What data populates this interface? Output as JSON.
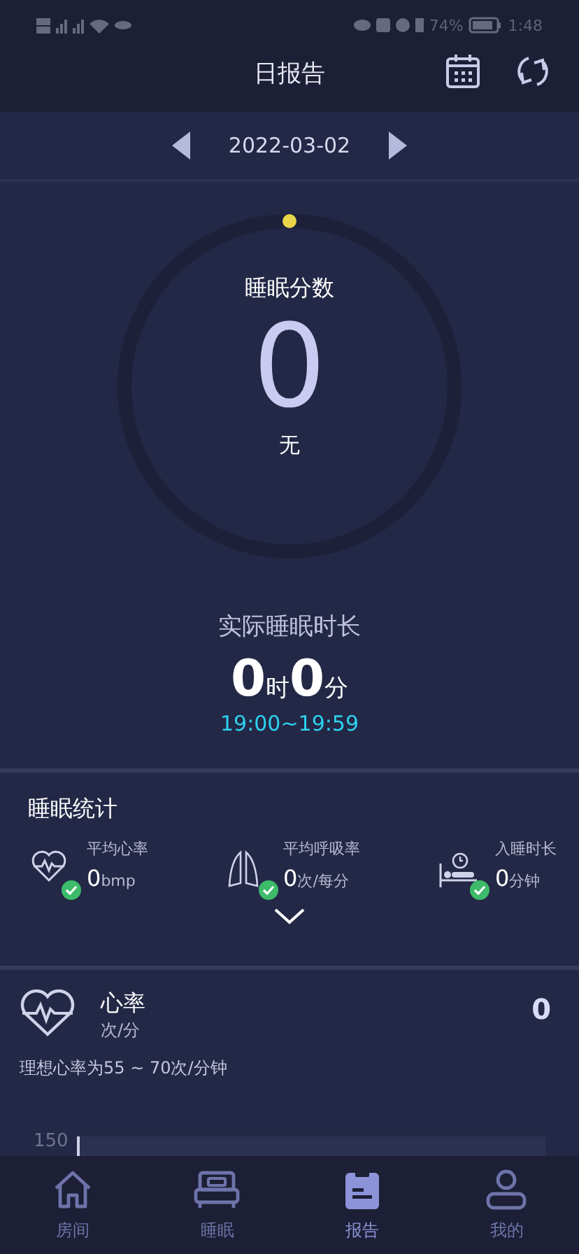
{
  "status_bar": {
    "battery": "74%",
    "time": "1:48"
  },
  "header": {
    "title": "日报告"
  },
  "date_bar": {
    "date": "2022-03-02"
  },
  "score": {
    "label": "睡眠分数",
    "value": "0",
    "grade": "无"
  },
  "duration": {
    "label": "实际睡眠时长",
    "hours": "0",
    "hours_unit": "时",
    "minutes": "0",
    "minutes_unit": "分",
    "range": "19:00~19:59"
  },
  "stats": {
    "title": "睡眠统计",
    "items": [
      {
        "kind": "heart",
        "label": "平均心率",
        "value": "0",
        "unit": "bmp",
        "ok": true
      },
      {
        "kind": "lungs",
        "label": "平均呼吸率",
        "value": "0",
        "unit": "次/每分",
        "ok": true
      },
      {
        "kind": "bed",
        "label": "入睡时长",
        "value": "0",
        "unit": "分钟",
        "ok": true
      }
    ]
  },
  "heart_rate": {
    "title": "心率",
    "unit": "次/分",
    "value": "0",
    "note": "理想心率为55 ~ 70次/分钟",
    "axis_label": "150"
  },
  "nav": [
    {
      "kind": "home",
      "label": "房间",
      "selected": false
    },
    {
      "kind": "bed",
      "label": "睡眠",
      "selected": false
    },
    {
      "kind": "report",
      "label": "报告",
      "selected": true
    },
    {
      "kind": "user",
      "label": "我的",
      "selected": false
    }
  ]
}
